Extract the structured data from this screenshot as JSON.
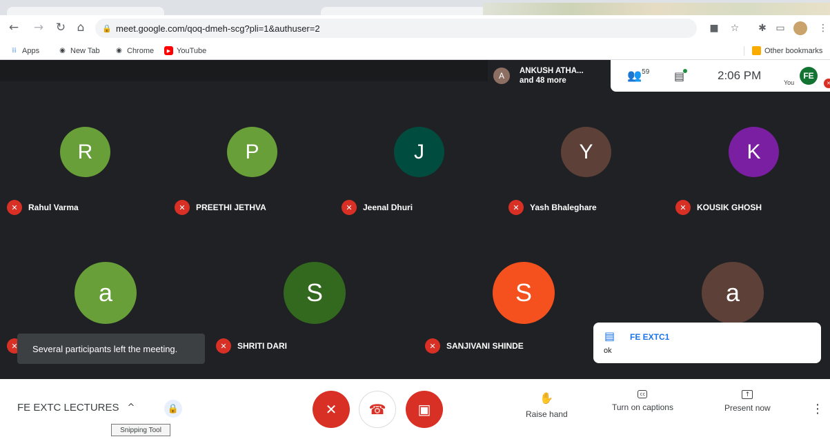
{
  "browser": {
    "url": "meet.google.com/qoq-dmeh-scg?pli=1&authuser=2",
    "bookmarks": [
      {
        "label": "Apps",
        "icon": "apps-grid-icon"
      },
      {
        "label": "New Tab",
        "icon": "chrome-icon"
      },
      {
        "label": "Chrome",
        "icon": "chrome-icon"
      },
      {
        "label": "YouTube",
        "icon": "youtube-icon"
      }
    ],
    "other_bookmarks": "Other bookmarks"
  },
  "meet": {
    "speaker": {
      "avatar_letter": "A",
      "line1": "ANKUSH ATHA...",
      "line2": "and 48 more"
    },
    "participant_count": "59",
    "clock": "2:06 PM",
    "self": {
      "label": "You",
      "initials": "FE"
    },
    "participants": [
      {
        "letter": "R",
        "name": "Rahul Varma",
        "color": "#689f38"
      },
      {
        "letter": "P",
        "name": "PREETHI JETHVA",
        "color": "#689f38"
      },
      {
        "letter": "J",
        "name": "Jeenal Dhuri",
        "color": "#004d40"
      },
      {
        "letter": "Y",
        "name": "Yash Bhaleghare",
        "color": "#5d4037"
      },
      {
        "letter": "K",
        "name": "KOUSIK GHOSH",
        "color": "#7b1fa2"
      },
      {
        "letter": "a",
        "name": "",
        "color": "#689f38"
      },
      {
        "letter": "S",
        "name": "SHRITI DARI",
        "color": "#33691e"
      },
      {
        "letter": "S",
        "name": "SANJIVANI SHINDE",
        "color": "#f4511e"
      },
      {
        "letter": "a",
        "name": "",
        "color": "#5d4037"
      }
    ],
    "toast": "Several participants left the meeting.",
    "chat": {
      "sender": "FE EXTC1",
      "message": "ok"
    },
    "meeting_title": "FE EXTC LECTURES",
    "tooltip": "Snipping Tool",
    "actions": {
      "raise_hand": "Raise hand",
      "captions": "Turn on captions",
      "present": "Present now"
    },
    "colors": {
      "danger": "#d93025",
      "accent": "#1a73e8"
    }
  }
}
